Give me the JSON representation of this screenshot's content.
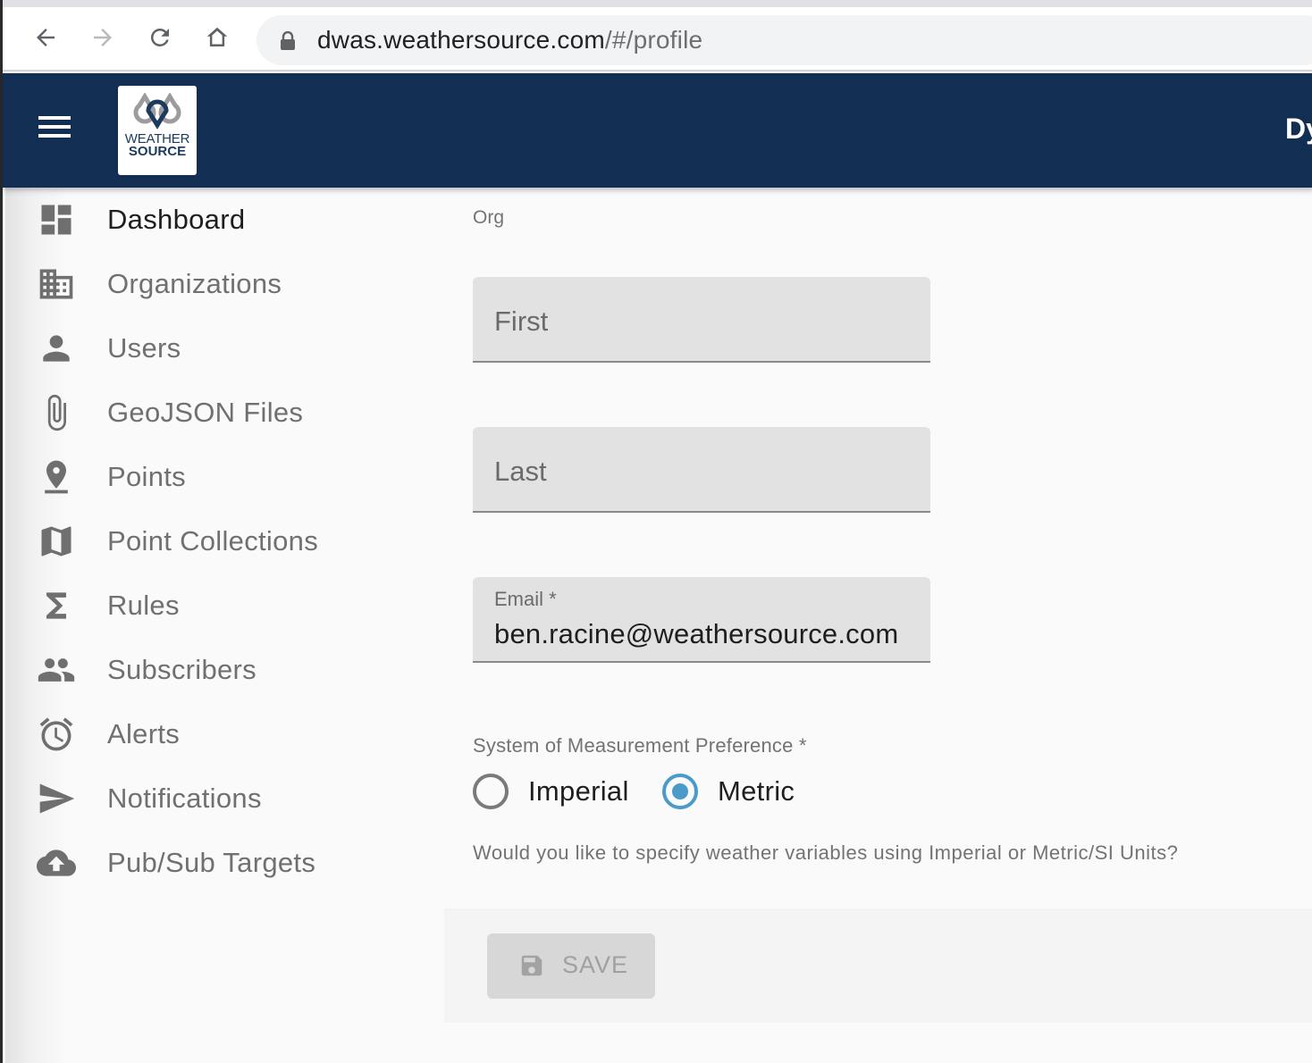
{
  "browser": {
    "url_host": "dwas.weathersource.com",
    "url_path": "/#/profile",
    "icons": [
      "back-arrow-icon",
      "forward-arrow-icon",
      "reload-icon",
      "home-icon",
      "lock-icon"
    ]
  },
  "appbar": {
    "logo_line1": "WEATHER",
    "logo_line2": "SOURCE",
    "title_partial": "Dy",
    "brand_color": "#122e53"
  },
  "sidebar": {
    "items": [
      {
        "label": "Dashboard",
        "icon": "dashboard-icon",
        "active": true
      },
      {
        "label": "Organizations",
        "icon": "building-icon",
        "active": false
      },
      {
        "label": "Users",
        "icon": "person-icon",
        "active": false
      },
      {
        "label": "GeoJSON Files",
        "icon": "paperclip-icon",
        "active": false
      },
      {
        "label": "Points",
        "icon": "pin-drop-icon",
        "active": false
      },
      {
        "label": "Point Collections",
        "icon": "map-icon",
        "active": false
      },
      {
        "label": "Rules",
        "icon": "sigma-icon",
        "active": false
      },
      {
        "label": "Subscribers",
        "icon": "people-icon",
        "active": false
      },
      {
        "label": "Alerts",
        "icon": "alarm-clock-icon",
        "active": false
      },
      {
        "label": "Notifications",
        "icon": "send-icon",
        "active": false
      },
      {
        "label": "Pub/Sub Targets",
        "icon": "cloud-upload-icon",
        "active": false
      }
    ]
  },
  "form": {
    "org_label": "Org",
    "first": {
      "placeholder": "First",
      "value": ""
    },
    "last": {
      "placeholder": "Last",
      "value": ""
    },
    "email": {
      "label": "Email *",
      "value": "ben.racine@weathersource.com"
    },
    "measurement": {
      "label": "System of Measurement Preference *",
      "options": [
        {
          "label": "Imperial",
          "checked": false
        },
        {
          "label": "Metric",
          "checked": true
        }
      ],
      "helper": "Would you like to specify weather variables using Imperial or Metric/SI Units?",
      "accent_color": "#4a9bca"
    },
    "save": {
      "label": "SAVE",
      "icon": "save-icon",
      "disabled": true
    }
  }
}
